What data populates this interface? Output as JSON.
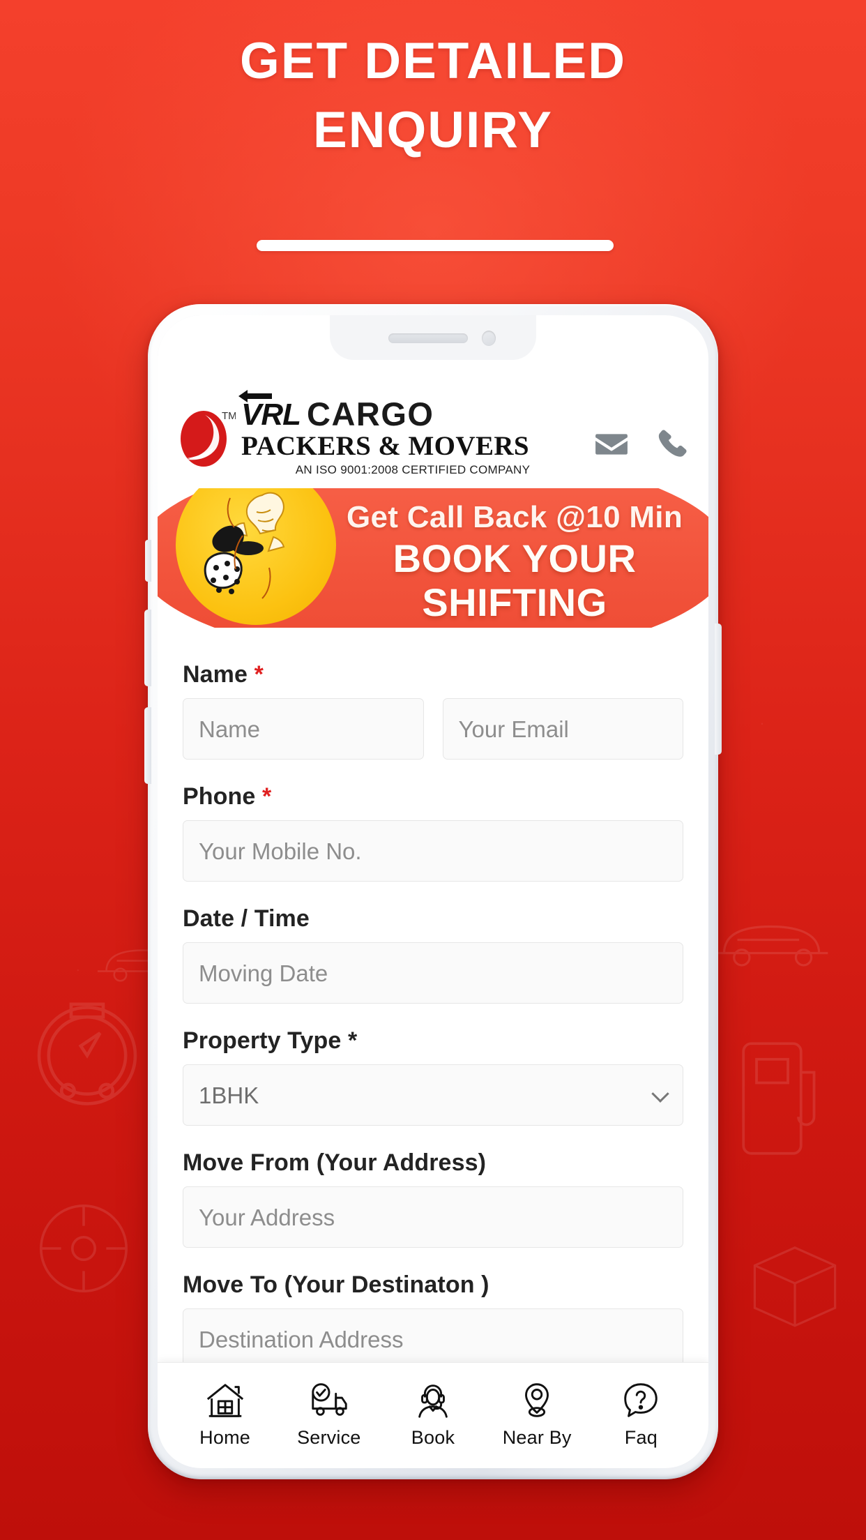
{
  "poster": {
    "headline_line1": "GET DETAILED",
    "headline_line2": "ENQUIRY",
    "background_color_top": "#F4402C",
    "background_color_bottom": "#BE0F0A",
    "divider": "title-divider"
  },
  "app": {
    "header": {
      "logo": {
        "brand_vrl": "VRL",
        "brand_cargo": "CARGO",
        "brand_packers_movers": "PACKERS & MOVERS",
        "iso_line": "AN ISO 9001:2008 CERTIFIED COMPANY",
        "trademark": "TM",
        "mark_color": "#D51A1A"
      },
      "actions": [
        {
          "name": "email-icon",
          "label": "Email"
        },
        {
          "name": "phone-icon",
          "label": "Call"
        }
      ],
      "icon_color": "#7E868C"
    },
    "banner": {
      "line1": "Get Call Back @10 Min",
      "line2": "BOOK YOUR SHIFTING",
      "bg_color": "#F2543C",
      "accent_color": "#FCC211"
    },
    "form": {
      "fields": [
        {
          "label": "Name",
          "required": true,
          "type": "pair",
          "inputs": [
            {
              "name": "name-input",
              "placeholder": "Name",
              "value": ""
            },
            {
              "name": "email-input",
              "placeholder": "Your Email",
              "value": ""
            }
          ]
        },
        {
          "label": "Phone",
          "required": true,
          "type": "text",
          "inputs": [
            {
              "name": "phone-input",
              "placeholder": "Your Mobile No.",
              "value": ""
            }
          ]
        },
        {
          "label": "Date / Time",
          "required": false,
          "type": "text",
          "inputs": [
            {
              "name": "moving-date-input",
              "placeholder": "Moving Date",
              "value": ""
            }
          ]
        },
        {
          "label": "Property Type *",
          "required": false,
          "type": "select",
          "inputs": [
            {
              "name": "property-type-select",
              "placeholder": "1BHK",
              "value": "1BHK"
            }
          ]
        },
        {
          "label": "Move From (Your Address)",
          "required": false,
          "type": "text",
          "inputs": [
            {
              "name": "move-from-input",
              "placeholder": "Your Address",
              "value": ""
            }
          ]
        },
        {
          "label": "Move To (Your Destinaton )",
          "required": false,
          "type": "text",
          "inputs": [
            {
              "name": "move-to-input",
              "placeholder": "Destination Address",
              "value": ""
            }
          ]
        }
      ],
      "required_marker": "*"
    },
    "bottom_nav": {
      "items": [
        {
          "label": "Home",
          "icon": "house-icon"
        },
        {
          "label": "Service",
          "icon": "truck-check-icon"
        },
        {
          "label": "Book",
          "icon": "headset-agent-icon"
        },
        {
          "label": "Near By",
          "icon": "map-pin-icon"
        },
        {
          "label": "Faq",
          "icon": "question-bubble-icon"
        }
      ]
    }
  },
  "labels": {
    "name_label": "Name",
    "phone_label": "Phone",
    "datetime_label": "Date / Time",
    "property_label": "Property Type *",
    "movefrom_label": "Move From (Your Address)",
    "moveto_label": "Move To (Your Destinaton )"
  }
}
